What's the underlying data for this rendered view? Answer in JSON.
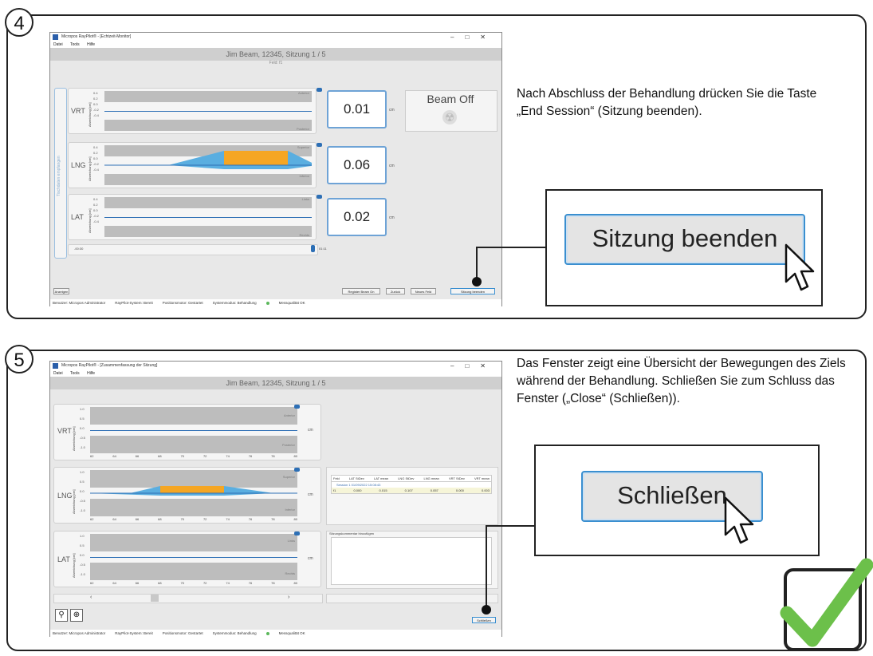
{
  "step4": {
    "number": "4",
    "window": {
      "title": "Micropos RayPilot® - [Echtzeit-Monitor]",
      "menu": [
        "Datei",
        "Tools",
        "Hilfe"
      ],
      "patient_header": "Jim Beam, 12345, Sitzung 1 / 5",
      "field": "Feld: f1",
      "sidebar_text": "Tischdaten empfangen",
      "y_axis_label": "Abweichung [cm]",
      "ticks": [
        "0.4",
        "0.2",
        "0.0",
        "-0.2",
        "-0.4"
      ],
      "rows": [
        {
          "name": "VRT",
          "top_band": "Anterior",
          "bottom_band": "Posterior",
          "value": "0.01",
          "unit": "cm"
        },
        {
          "name": "LNG",
          "top_band": "Superior",
          "bottom_band": "Inferior",
          "value": "0.06",
          "unit": "cm"
        },
        {
          "name": "LAT",
          "top_band": "Links",
          "bottom_band": "Rechts",
          "value": "0.02",
          "unit": "cm"
        }
      ],
      "beam_status": "Beam Off",
      "timeline_start": "-00:30",
      "timeline_end": "01:11",
      "buttons": {
        "show": "Anzeigen",
        "register": "Register Beam On",
        "back": "Zurück",
        "new_field": "Neues Feld",
        "end": "Sitzung beenden"
      },
      "status": {
        "user": "Benutzer: Micropos Administrator",
        "system": "RayPilot-System: Bereit",
        "motor": "Positionsmotor: Gestartet",
        "mode": "Systemmodus: Behandlung",
        "quality": "Messqualität OK"
      }
    },
    "instruction": "Nach Abschluss der Behandlung drücken Sie die Taste „End Session“ (Sitzung beenden).",
    "callout_button": "Sitzung beenden"
  },
  "step5": {
    "number": "5",
    "window": {
      "title": "Micropos RayPilot® - [Zusammenfassung der Sitzung]",
      "menu": [
        "Datei",
        "Tools",
        "Hilfe"
      ],
      "patient_header": "Jim Beam, 12345, Sitzung 1 / 5",
      "y_axis_label": "Abweichung [cm]",
      "ticks": [
        "1.0",
        "0.5",
        "0.0",
        "-0.5",
        "-1.0"
      ],
      "x_ticks": [
        "62",
        "64",
        "66",
        "68",
        "70",
        "72",
        "74",
        "76",
        "78",
        "80"
      ],
      "rows": [
        {
          "name": "VRT",
          "top_band": "Anterior",
          "bottom_band": "Posterior",
          "unit": "cm"
        },
        {
          "name": "LNG",
          "top_band": "Superior",
          "bottom_band": "Inferior",
          "unit": "cm"
        },
        {
          "name": "LAT",
          "top_band": "Links",
          "bottom_band": "Rechts",
          "unit": "cm"
        }
      ],
      "table": {
        "headers": [
          "Feld",
          "LAT StDev",
          "LAT mean",
          "LNG StDev",
          "LNG mean",
          "VRT StDev",
          "VRT mean"
        ],
        "session": "Session 1 01/09/2022 15:08:43",
        "row": [
          "f1",
          "0.000",
          "0.015",
          "0.107",
          "0.057",
          "0.000",
          "0.003"
        ]
      },
      "comment_label": "Sitzungskommentar hinzufügen",
      "scroll_left": "‹",
      "scroll_right": "›",
      "close_button": "Schließen",
      "status": {
        "user": "Benutzer: Micropos Administrator",
        "system": "RayPilot-System: Bereit",
        "motor": "Positionsmotor: Gestartet",
        "mode": "Systemmodus: Behandlung",
        "quality": "Messqualität OK"
      }
    },
    "instruction": "Das Fenster zeigt eine Übersicht der Bewegungen des Ziels während der Behandlung. Schließen Sie zum Schluss das Fenster („Close“ (Schließen)).",
    "callout_button": "Schließen"
  },
  "colors": {
    "accent": "#3a8fd0",
    "check": "#6cc04a",
    "tracking_fill": "#5aaee0",
    "beam_fill": "#f5a623"
  }
}
